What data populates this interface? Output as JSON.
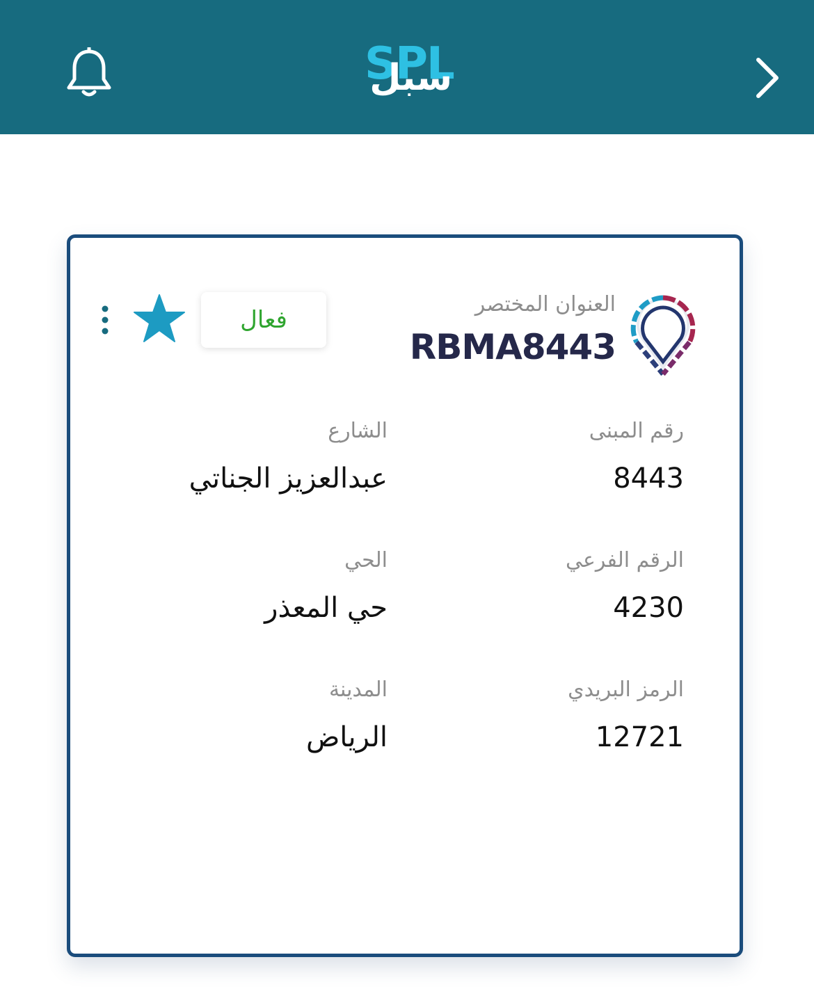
{
  "header": {
    "logo": {
      "latin": "SPL",
      "arabic": "سبل"
    },
    "icons": {
      "notifications": "bell-icon",
      "back": "chevron-right-icon"
    },
    "colors": {
      "background": "#176b7f",
      "logo_accent": "#2ec0e3"
    }
  },
  "card": {
    "short_address_label": "العنوان المختصر",
    "short_address_code": "RBMA8443",
    "status": "فعال",
    "status_color": "#2fa52f",
    "favorite_icon": "star-icon",
    "favorite_color": "#1d9bc2",
    "menu_icon": "more-vertical-icon",
    "pin_icon": "location-pin-icon",
    "fields": {
      "building_number": {
        "label": "رقم المبنى",
        "value": "8443"
      },
      "street": {
        "label": "الشارع",
        "value": "عبدالعزيز الجناتي"
      },
      "secondary_number": {
        "label": "الرقم الفرعي",
        "value": "4230"
      },
      "district": {
        "label": "الحي",
        "value": "حي المعذر"
      },
      "postal_code": {
        "label": "الرمز البريدي",
        "value": "12721"
      },
      "city": {
        "label": "المدينة",
        "value": "الرياض"
      }
    }
  }
}
